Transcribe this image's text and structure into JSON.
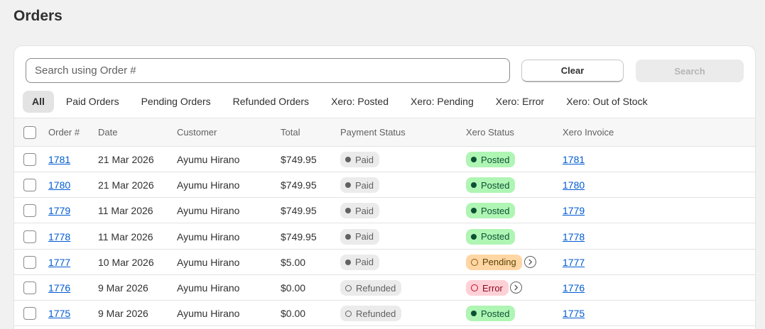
{
  "page": {
    "title": "Orders"
  },
  "search": {
    "placeholder": "Search using Order #",
    "value": "",
    "clear_label": "Clear",
    "search_label": "Search"
  },
  "tabs": [
    {
      "label": "All",
      "active": true
    },
    {
      "label": "Paid Orders"
    },
    {
      "label": "Pending Orders"
    },
    {
      "label": "Refunded Orders"
    },
    {
      "label": "Xero: Posted"
    },
    {
      "label": "Xero: Pending"
    },
    {
      "label": "Xero: Error"
    },
    {
      "label": "Xero: Out of Stock"
    }
  ],
  "table": {
    "headers": [
      "Order #",
      "Date",
      "Customer",
      "Total",
      "Payment Status",
      "Xero Status",
      "Xero Invoice"
    ],
    "rows": [
      {
        "order": "1781",
        "date": "21 Mar 2026",
        "customer": "Ayumu Hirano",
        "total": "$749.95",
        "payment": "Paid",
        "xero": "Posted",
        "invoice": "1781"
      },
      {
        "order": "1780",
        "date": "21 Mar 2026",
        "customer": "Ayumu Hirano",
        "total": "$749.95",
        "payment": "Paid",
        "xero": "Posted",
        "invoice": "1780"
      },
      {
        "order": "1779",
        "date": "11 Mar 2026",
        "customer": "Ayumu Hirano",
        "total": "$749.95",
        "payment": "Paid",
        "xero": "Posted",
        "invoice": "1779"
      },
      {
        "order": "1778",
        "date": "11 Mar 2026",
        "customer": "Ayumu Hirano",
        "total": "$749.95",
        "payment": "Paid",
        "xero": "Posted",
        "invoice": "1778"
      },
      {
        "order": "1777",
        "date": "10 Mar 2026",
        "customer": "Ayumu Hirano",
        "total": "$5.00",
        "payment": "Paid",
        "xero": "Pending",
        "invoice": "1777"
      },
      {
        "order": "1776",
        "date": "9 Mar 2026",
        "customer": "Ayumu Hirano",
        "total": "$0.00",
        "payment": "Refunded",
        "xero": "Error",
        "invoice": "1776"
      },
      {
        "order": "1775",
        "date": "9 Mar 2026",
        "customer": "Ayumu Hirano",
        "total": "$0.00",
        "payment": "Refunded",
        "xero": "Posted",
        "invoice": "1775"
      }
    ]
  },
  "colors": {
    "link": "#005bd3",
    "posted_bg": "#aff5b4",
    "pending_bg": "#ffd6a4",
    "error_bg": "#fed1d7",
    "neutral_bg": "#ebebeb"
  }
}
